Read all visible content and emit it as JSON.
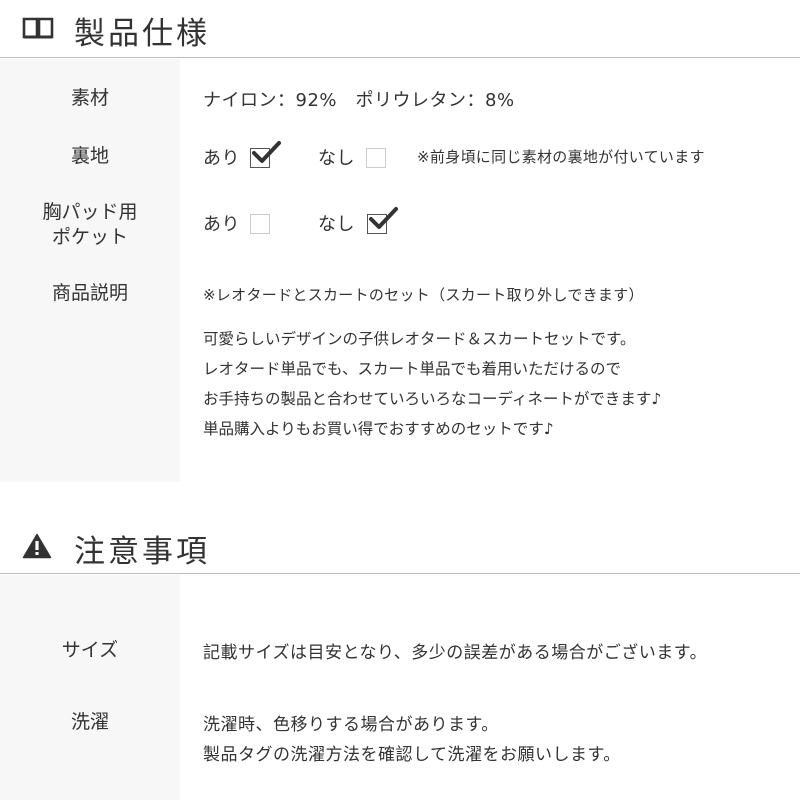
{
  "spec_section": {
    "icon": "book-icon",
    "title": "製品仕様",
    "rows": {
      "material": {
        "label": "素材",
        "value": "ナイロン：92%　ポリウレタン：8%"
      },
      "lining": {
        "label": "裏地",
        "opt_yes": "あり",
        "opt_no": "なし",
        "yes_checked": true,
        "no_checked": false,
        "note": "※前身頃に同じ素材の裏地が付いています"
      },
      "pad_pocket": {
        "label_line1": "胸パッド用",
        "label_line2": "ポケット",
        "opt_yes": "あり",
        "opt_no": "なし",
        "yes_checked": false,
        "no_checked": true
      },
      "description": {
        "label": "商品説明",
        "note": "※レオタードとスカートのセット（スカート取り外しできます）",
        "lines": [
          "可愛らしいデザインの子供レオタード＆スカートセットです。",
          "レオタード単品でも、スカート単品でも着用いただけるので",
          "お手持ちの製品と合わせていろいろなコーディネートができます♪",
          "単品購入よりもお買い得でおすすめのセットです♪"
        ]
      }
    }
  },
  "caution_section": {
    "icon": "warning-icon",
    "title": "注意事項",
    "rows": {
      "size": {
        "label": "サイズ",
        "text": "記載サイズは目安となり、多少の誤差がある場合がございます。"
      },
      "washing": {
        "label": "洗濯",
        "lines": [
          "洗濯時、色移りする場合があります。",
          "製品タグの洗濯方法を確認して洗濯をお願いします。"
        ]
      }
    }
  },
  "colors": {
    "text": "#333333",
    "label_bg": "#f7f7f7",
    "divider": "#bdbdbd",
    "checkbox_border": "#cccccc"
  }
}
